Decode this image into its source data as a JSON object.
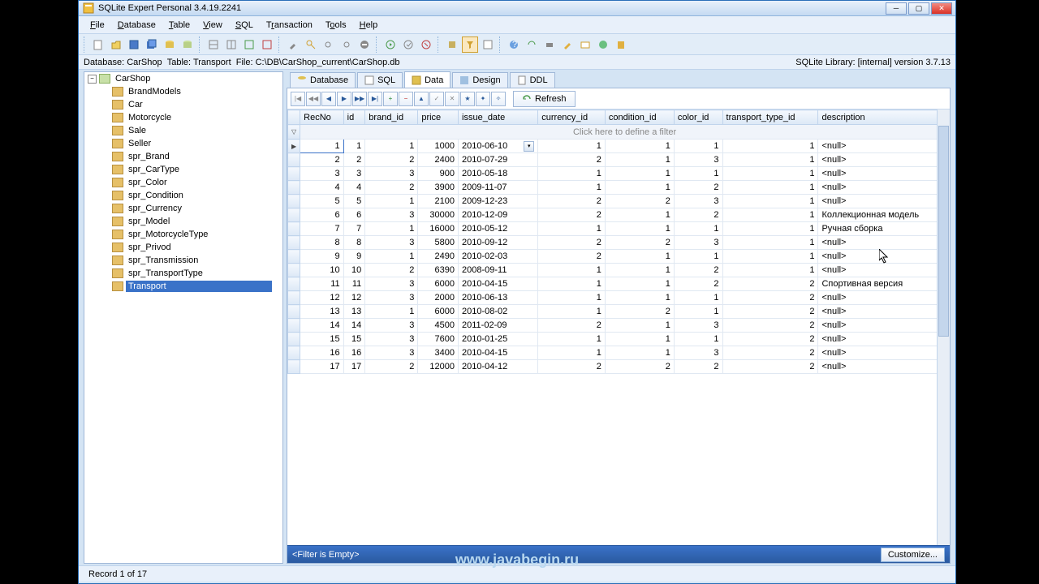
{
  "title": "SQLite Expert Personal 3.4.19.2241",
  "menu": [
    "File",
    "Database",
    "Table",
    "View",
    "SQL",
    "Transaction",
    "Tools",
    "Help"
  ],
  "info_db": "Database: CarShop",
  "info_table": "Table: Transport",
  "info_file": "File: C:\\DB\\CarShop_current\\CarShop.db",
  "info_lib": "SQLite Library: [internal] version 3.7.13",
  "tree_root": "CarShop",
  "tree_items": [
    "BrandModels",
    "Car",
    "Motorcycle",
    "Sale",
    "Seller",
    "spr_Brand",
    "spr_CarType",
    "spr_Color",
    "spr_Condition",
    "spr_Currency",
    "spr_Model",
    "spr_MotorcycleType",
    "spr_Privod",
    "spr_Transmission",
    "spr_TransportType",
    "Transport"
  ],
  "tabs": [
    "Database",
    "SQL",
    "Data",
    "Design",
    "DDL"
  ],
  "active_tab": 2,
  "refresh_label": "Refresh",
  "filter_hint": "Click here to define a filter",
  "columns": [
    "RecNo",
    "id",
    "brand_id",
    "price",
    "issue_date",
    "currency_id",
    "condition_id",
    "color_id",
    "transport_type_id",
    "description"
  ],
  "rows": [
    [
      1,
      1,
      1,
      1000,
      "2010-06-10",
      1,
      1,
      1,
      1,
      "<null>"
    ],
    [
      2,
      2,
      2,
      2400,
      "2010-07-29",
      2,
      1,
      3,
      1,
      "<null>"
    ],
    [
      3,
      3,
      3,
      900,
      "2010-05-18",
      1,
      1,
      1,
      1,
      "<null>"
    ],
    [
      4,
      4,
      2,
      3900,
      "2009-11-07",
      1,
      1,
      2,
      1,
      "<null>"
    ],
    [
      5,
      5,
      1,
      2100,
      "2009-12-23",
      2,
      2,
      3,
      1,
      "<null>"
    ],
    [
      6,
      6,
      3,
      30000,
      "2010-12-09",
      2,
      1,
      2,
      1,
      "Коллекционная модель"
    ],
    [
      7,
      7,
      1,
      16000,
      "2010-05-12",
      1,
      1,
      1,
      1,
      "Ручная сборка"
    ],
    [
      8,
      8,
      3,
      5800,
      "2010-09-12",
      2,
      2,
      3,
      1,
      "<null>"
    ],
    [
      9,
      9,
      1,
      2490,
      "2010-02-03",
      2,
      1,
      1,
      1,
      "<null>"
    ],
    [
      10,
      10,
      2,
      6390,
      "2008-09-11",
      1,
      1,
      2,
      1,
      "<null>"
    ],
    [
      11,
      11,
      3,
      6000,
      "2010-04-15",
      1,
      1,
      2,
      2,
      "Спортивная версия"
    ],
    [
      12,
      12,
      3,
      2000,
      "2010-06-13",
      1,
      1,
      1,
      2,
      "<null>"
    ],
    [
      13,
      13,
      1,
      6000,
      "2010-08-02",
      1,
      2,
      1,
      2,
      "<null>"
    ],
    [
      14,
      14,
      3,
      4500,
      "2011-02-09",
      2,
      1,
      3,
      2,
      "<null>"
    ],
    [
      15,
      15,
      3,
      7600,
      "2010-01-25",
      1,
      1,
      1,
      2,
      "<null>"
    ],
    [
      16,
      16,
      3,
      3400,
      "2010-04-15",
      1,
      1,
      3,
      2,
      "<null>"
    ],
    [
      17,
      17,
      2,
      12000,
      "2010-04-12",
      2,
      2,
      2,
      2,
      "<null>"
    ]
  ],
  "filter_empty": "<Filter is Empty>",
  "customize_label": "Customize...",
  "status_record": "Record 1 of 17",
  "watermark": "www.javabegin.ru"
}
